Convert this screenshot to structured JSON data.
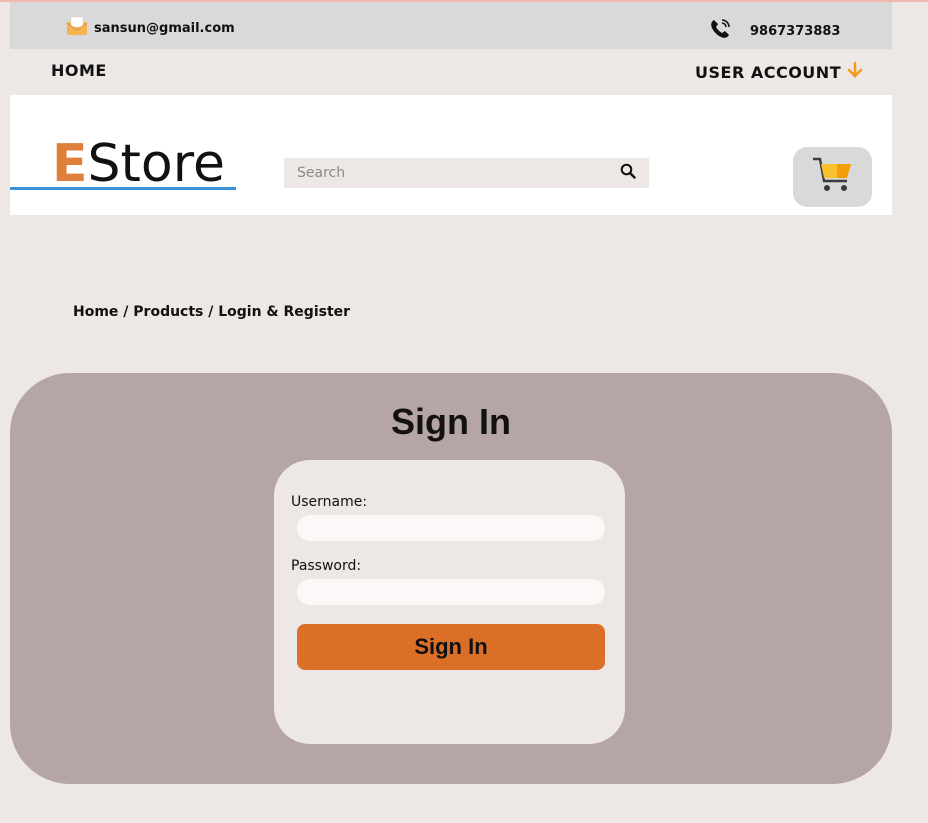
{
  "topbar": {
    "email": "sansun@gmail.com",
    "email_icon": "envelope-icon",
    "phone": "9867373883",
    "phone_icon": "phone-icon"
  },
  "nav": {
    "home": "HOME",
    "user_account": "USER ACCOUNT",
    "user_account_icon": "arrow-down-icon"
  },
  "header": {
    "logo_first": "E",
    "logo_rest": "Store",
    "search_placeholder": "Search",
    "search_icon": "search-icon",
    "cart_icon": "cart-icon"
  },
  "breadcrumb": "Home / Products / Login & Register",
  "signin": {
    "title": "Sign In",
    "username_label": "Username:",
    "username_value": "",
    "password_label": "Password:",
    "password_value": "",
    "button_label": "Sign In"
  },
  "colors": {
    "accent": "#dc6f28",
    "logo_e": "#e07f3c",
    "panel": "#b5a5a4",
    "background": "#ede8e6"
  }
}
